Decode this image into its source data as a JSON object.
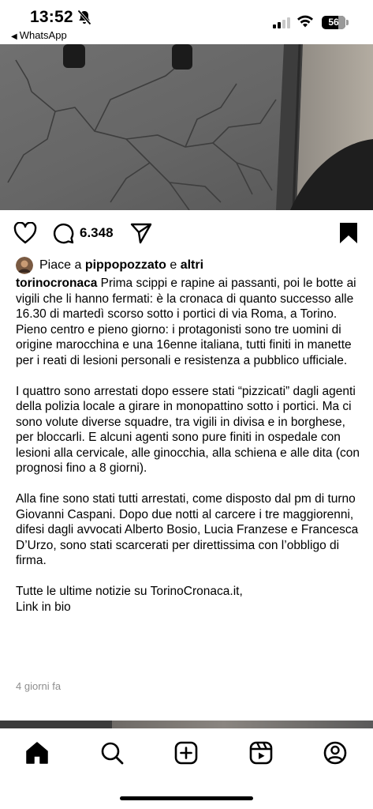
{
  "status_bar": {
    "time": "13:52",
    "back_app": "WhatsApp",
    "battery": "56"
  },
  "post": {
    "comment_count": "6.348",
    "likes": {
      "prefix": "Piace a ",
      "user": "pippopozzato",
      "conjunction": " e ",
      "others": "altri"
    },
    "caption": {
      "username": "torinocronaca",
      "paragraphs": [
        "Prima scippi e rapine ai passanti, poi le botte ai vigili che li hanno fermati: è la cronaca di quanto successo alle 16.30 di martedì scorso sotto i portici di via Roma, a Torino. Pieno centro e pieno giorno: i protagonisti sono tre uomini di origine marocchina e una 16enne italiana, tutti finiti in manette per i reati di lesioni personali e resistenza a pubblico ufficiale.",
        "I quattro sono arrestati dopo essere stati “pizzicati” dagli agenti della polizia locale a girare in monopattino sotto i portici. Ma ci sono volute diverse squadre, tra vigili in divisa e in borghese, per bloccarli. E alcuni agenti sono pure finiti in ospedale con lesioni alla cervicale, alle ginocchia, alla schiena e alle dita (con prognosi fino a 8 giorni).",
        "Alla fine sono stati tutti arrestati, come disposto dal pm di turno Giovanni Caspani. Dopo due notti al carcere i tre maggiorenni, difesi dagli avvocati Alberto Bosio, Lucia Franzese e Francesca D’Urzo, sono stati scarcerati per direttissima con l’obbligo di firma.",
        "Tutte le ultime notizie su TorinoCronaca.it,"
      ],
      "last_line": "Link in bio"
    },
    "time_ago": "4 giorni fa"
  },
  "icons": {
    "like": "heart-icon",
    "comment": "comment-icon",
    "share": "send-icon",
    "save": "bookmark-icon",
    "tabs": [
      "home-icon",
      "search-icon",
      "create-icon",
      "reels-icon",
      "profile-icon"
    ]
  },
  "colors": {
    "text": "#000000",
    "muted": "#8e8e8e",
    "background": "#ffffff"
  }
}
